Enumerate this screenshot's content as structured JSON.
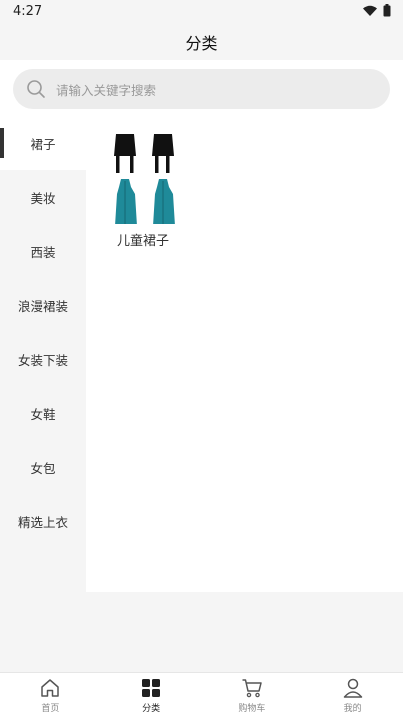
{
  "status_bar": {
    "time": "4:27"
  },
  "header": {
    "title": "分类"
  },
  "search": {
    "placeholder": "请输入关键字搜索"
  },
  "sidebar": {
    "items": [
      {
        "label": "裙子",
        "active": true
      },
      {
        "label": "美妆"
      },
      {
        "label": "西装"
      },
      {
        "label": "浪漫裙装"
      },
      {
        "label": "女装下装"
      },
      {
        "label": "女鞋"
      },
      {
        "label": "女包"
      },
      {
        "label": "精选上衣"
      }
    ]
  },
  "content": {
    "categories": [
      {
        "label": "儿童裙子",
        "icon": "skirts-product-image"
      }
    ]
  },
  "tabbar": {
    "items": [
      {
        "label": "首页",
        "icon": "home-icon"
      },
      {
        "label": "分类",
        "icon": "category-grid-icon",
        "active": true
      },
      {
        "label": "购物车",
        "icon": "cart-icon"
      },
      {
        "label": "我的",
        "icon": "user-icon"
      }
    ]
  },
  "colors": {
    "accent": "#333333",
    "dress_teal": "#1f8a99",
    "skirt_black": "#111111"
  }
}
